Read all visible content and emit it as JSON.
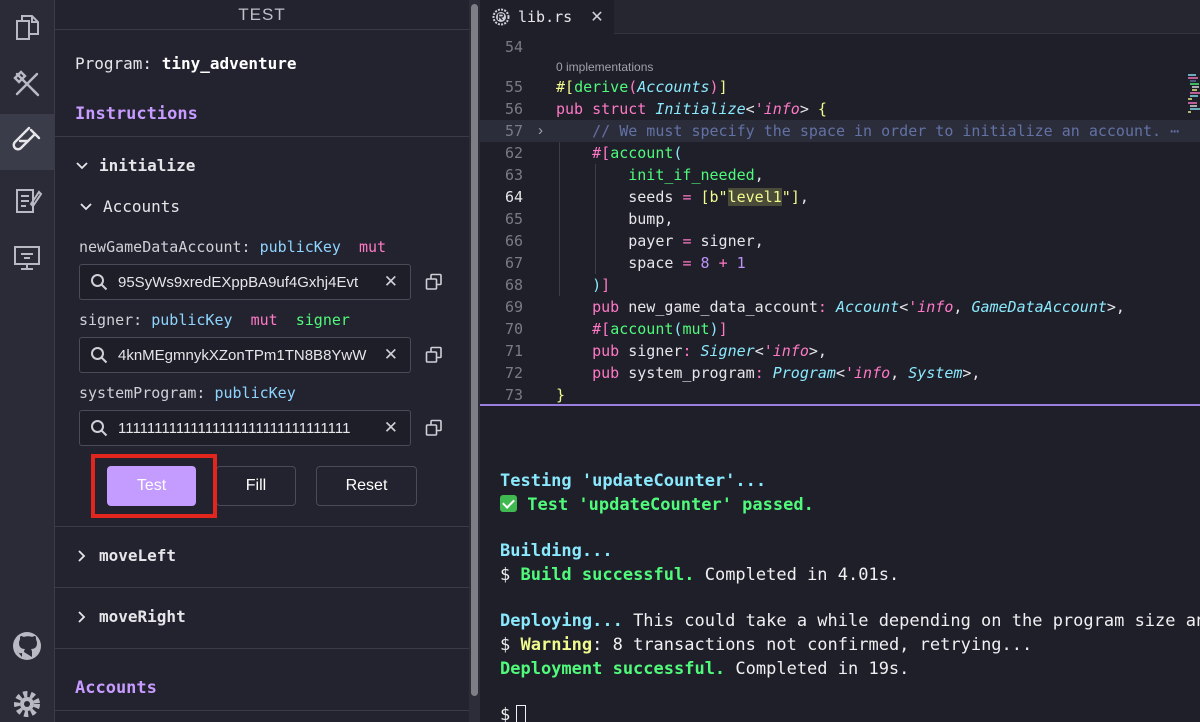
{
  "sidebar": {
    "title": "TEST",
    "program_label": "Program:",
    "program_name": "tiny_adventure",
    "instructions_header": "Instructions",
    "accounts_header": "Accounts",
    "instruction_initialize": "initialize",
    "accounts_group": "Accounts",
    "accounts": [
      {
        "name": "newGameDataAccount:",
        "type": "publicKey",
        "mut": "mut",
        "signer": "",
        "value": "95SyWs9xredEXppBA9uf4Gxhj4Evt"
      },
      {
        "name": "signer:",
        "type": "publicKey",
        "mut": "mut",
        "signer": "signer",
        "value": "4knMEgmnykXZonTPm1TN8B8YwW"
      },
      {
        "name": "systemProgram:",
        "type": "publicKey",
        "mut": "",
        "signer": "",
        "value": "11111111111111111111111111111111"
      }
    ],
    "buttons": {
      "test": "Test",
      "fill": "Fill",
      "reset": "Reset"
    },
    "instruction_move_left": "moveLeft",
    "instruction_move_right": "moveRight"
  },
  "editor": {
    "tab_label": "lib.rs",
    "codelens": "0 implementations",
    "line_numbers": [
      "54",
      "55",
      "56",
      "57",
      "62",
      "63",
      "64",
      "65",
      "66",
      "67",
      "68",
      "69",
      "70",
      "71",
      "72",
      "73"
    ],
    "active_line": "64"
  },
  "terminal": {
    "lines": [
      {
        "parts": [
          {
            "c": "t-cyan",
            "t": "Testing 'updateCounter'..."
          }
        ]
      },
      {
        "check": true,
        "parts": [
          {
            "c": "t-green",
            "t": " Test 'updateCounter' passed."
          }
        ]
      },
      {
        "parts": []
      },
      {
        "parts": [
          {
            "c": "t-cyan",
            "t": "Building..."
          }
        ]
      },
      {
        "parts": [
          {
            "c": "t-white",
            "t": "$ "
          },
          {
            "c": "t-green",
            "t": "Build successful."
          },
          {
            "c": "t-white",
            "t": " Completed in 4.01s."
          }
        ]
      },
      {
        "parts": []
      },
      {
        "parts": [
          {
            "c": "t-cyan",
            "t": "Deploying..."
          },
          {
            "c": "t-white",
            "t": " This could take a while depending on the program size and network conditions."
          }
        ]
      },
      {
        "parts": [
          {
            "c": "t-white",
            "t": "$ "
          },
          {
            "c": "t-yellow",
            "t": "Warning"
          },
          {
            "c": "t-white",
            "t": ": 8 transactions not confirmed, retrying..."
          }
        ]
      },
      {
        "parts": [
          {
            "c": "t-green",
            "t": "Deployment successful."
          },
          {
            "c": "t-white",
            "t": " Completed in 19s."
          }
        ]
      },
      {
        "parts": []
      },
      {
        "prompt": "$"
      }
    ]
  },
  "colors": {
    "accent_purple": "#c49cff",
    "highlight_red": "#e2261e",
    "terminal_green": "#50fa7b",
    "terminal_cyan": "#8be9fd"
  }
}
